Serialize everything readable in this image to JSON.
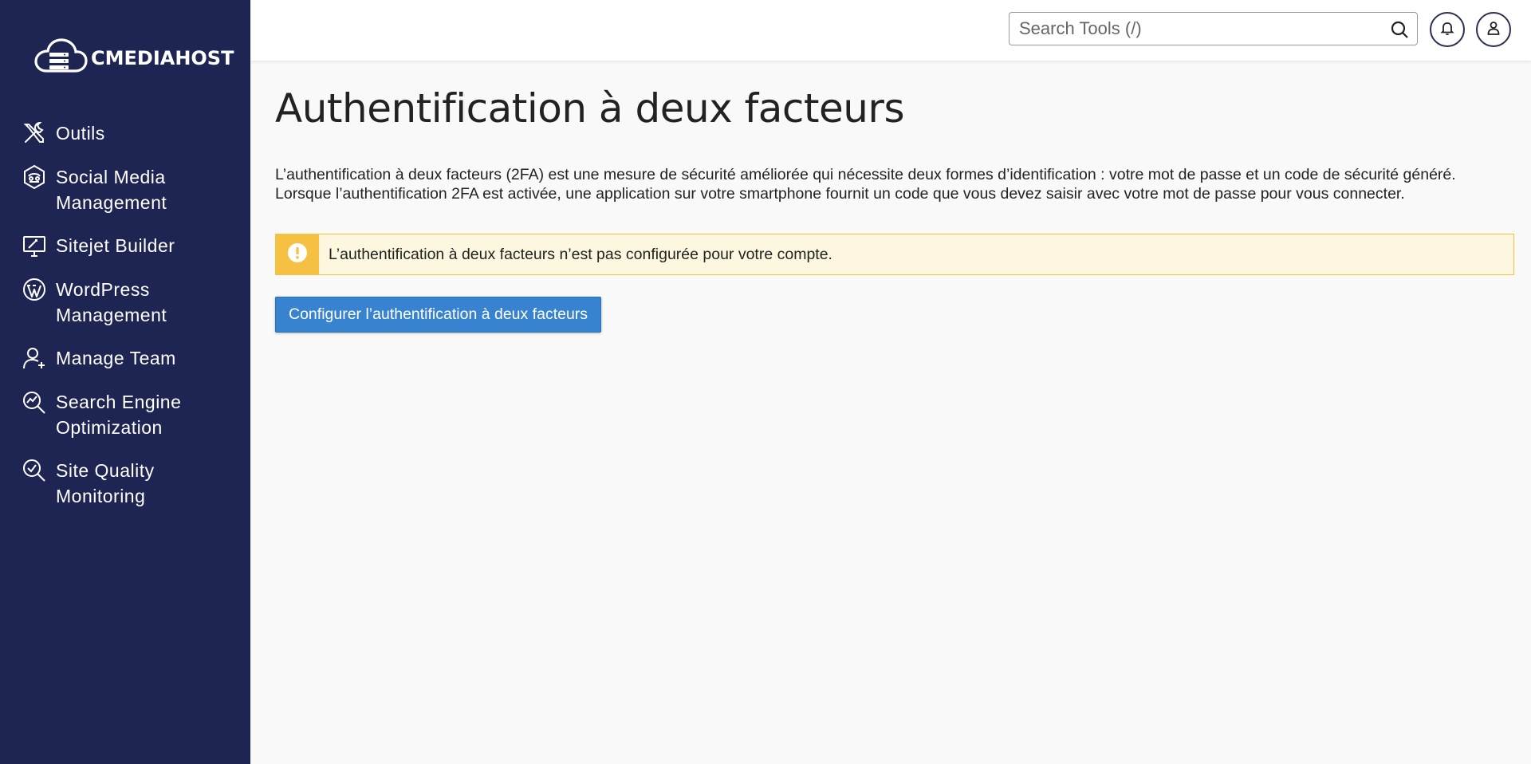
{
  "brand": {
    "name": "CMEDIAHOST",
    "logo_icon": "cloud-server-icon"
  },
  "sidebar": {
    "items": [
      {
        "label_line1": "Outils",
        "label_line2": "",
        "icon": "tools-icon"
      },
      {
        "label_line1": "Social Media",
        "label_line2": "Management",
        "icon": "social-media-icon"
      },
      {
        "label_line1": "Sitejet Builder",
        "label_line2": "",
        "icon": "monitor-design-icon"
      },
      {
        "label_line1": "WordPress",
        "label_line2": "Management",
        "icon": "wordpress-icon"
      },
      {
        "label_line1": "Manage Team",
        "label_line2": "",
        "icon": "user-plus-icon"
      },
      {
        "label_line1": "Search Engine",
        "label_line2": "Optimization",
        "icon": "seo-chart-icon"
      },
      {
        "label_line1": "Site Quality",
        "label_line2": "Monitoring",
        "icon": "magnifier-check-icon"
      }
    ]
  },
  "header": {
    "search_placeholder": "Search Tools (/)",
    "search_icon": "search-icon",
    "notifications_icon": "bell-icon",
    "account_icon": "user-icon"
  },
  "main": {
    "title": "Authentification à deux facteurs",
    "description": "L’authentification à deux facteurs (2FA) est une mesure de sécurité améliorée qui nécessite deux formes d’identification : votre mot de passe et un code de sécurité généré. Lorsque l’authentification 2FA est activée, une application sur votre smartphone fournit un code que vous devez saisir avec votre mot de passe pour vous connecter.",
    "alert": {
      "icon": "warning-icon",
      "text": "L’authentification à deux facteurs n’est pas configurée pour votre compte."
    },
    "configure_button": "Configurer l’authentification à deux facteurs"
  },
  "colors": {
    "sidebar_bg": "#1e2553",
    "primary": "#3883cf",
    "warning": "#f6c143",
    "warning_bg": "#fdf7df"
  }
}
